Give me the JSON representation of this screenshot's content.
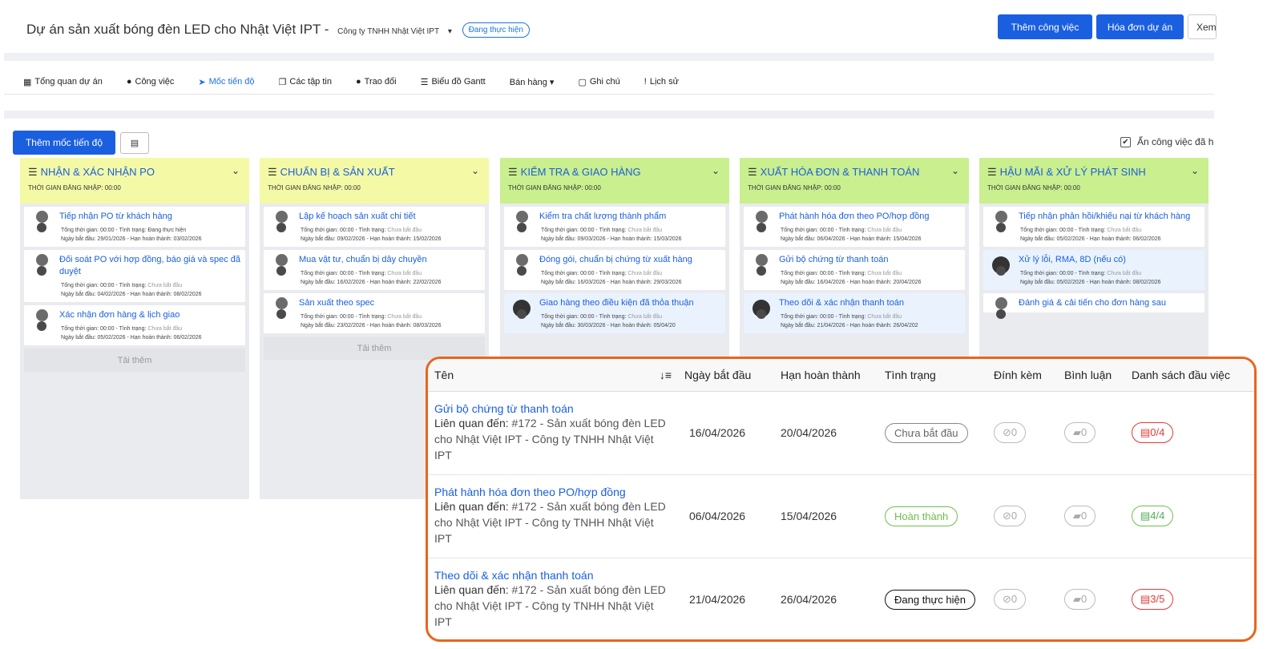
{
  "header": {
    "title": "Dự án sản xuất bóng đèn LED cho Nhật Việt IPT",
    "company": "Công ty TNHH Nhật Việt IPT",
    "status": "Đang thực hiện",
    "btn_add_task": "Thêm công việc",
    "btn_invoice": "Hóa đơn dự án",
    "btn_view": "Xem"
  },
  "nav": {
    "tabs": [
      {
        "icon": "▦",
        "label": "Tổng quan dự án"
      },
      {
        "icon": "●",
        "label": "Công việc"
      },
      {
        "icon": "➤",
        "label": "Mốc tiến độ"
      },
      {
        "icon": "❐",
        "label": "Các tập tin"
      },
      {
        "icon": "●",
        "label": "Trao đổi"
      },
      {
        "icon": "☰",
        "label": "Biểu đồ Gantt"
      },
      {
        "icon": "",
        "label": "Bán hàng ▾"
      },
      {
        "icon": "▢",
        "label": "Ghi chú"
      },
      {
        "icon": "!",
        "label": "Lịch sử"
      }
    ]
  },
  "controls": {
    "add_milestone": "Thêm mốc tiến độ",
    "hide_done": "Ẩn công việc đã h"
  },
  "columns": [
    {
      "name": "NHẬN & XÁC NHẬN PO",
      "sub": "THỜI GIAN ĐĂNG NHẬP: 00:00",
      "cards": [
        {
          "name": "Tiếp nhận PO từ khách hàng",
          "line1a": "Tổng thời gian: 00:00 - Tình trạng: ",
          "status": "Đang thực hiện",
          "line2": "Ngày bắt đầu: 29/01/2026 - Hạn hoàn thành: 03/02/2026"
        },
        {
          "name": "Đối soát PO với hợp đồng, báo giá và spec đã duyệt",
          "line1a": "Tổng thời gian: 00:00 - Tình trạng: ",
          "status": "Chưa bắt đầu",
          "line2": "Ngày bắt đầu: 04/02/2026 - Hạn hoàn thành: 08/02/2026"
        },
        {
          "name": "Xác nhận đơn hàng & lịch giao",
          "line1a": "Tổng thời gian: 00:00 - Tình trạng: ",
          "status": "Chưa bắt đầu",
          "line2": "Ngày bắt đầu: 05/02/2026 - Hạn hoàn thành: 06/02/2026"
        }
      ],
      "load_more": "Tải thêm"
    },
    {
      "name": "CHUẨN BỊ & SẢN XUẤT",
      "sub": "THỜI GIAN ĐĂNG NHẬP: 00:00",
      "cards": [
        {
          "name": "Lập kế hoạch sản xuất chi tiết",
          "line1a": "Tổng thời gian: 00:00 - Tình trạng: ",
          "status": "Chưa bắt đầu",
          "line2": "Ngày bắt đầu: 09/02/2026 - Hạn hoàn thành: 15/02/2026"
        },
        {
          "name": "Mua vật tư, chuẩn bị dây chuyền",
          "line1a": "Tổng thời gian: 00:00 - Tình trạng: ",
          "status": "Chưa bắt đầu",
          "line2": "Ngày bắt đầu: 16/02/2026 - Hạn hoàn thành: 22/02/2026"
        },
        {
          "name": "Sản xuất theo spec",
          "line1a": "Tổng thời gian: 00:00 - Tình trạng: ",
          "status": "Chưa bắt đầu",
          "line2": "Ngày bắt đầu: 23/02/2026 - Hạn hoàn thành: 08/03/2026"
        }
      ],
      "load_more": "Tải thêm"
    },
    {
      "name": "KIỂM TRA & GIAO HÀNG",
      "sub": "THỜI GIAN ĐĂNG NHẬP: 00:00",
      "cards": [
        {
          "name": "Kiểm tra chất lượng thành phẩm",
          "line1a": "Tổng thời gian: 00:00 - Tình trạng: ",
          "status": "Chưa bắt đầu",
          "line2": "Ngày bắt đầu: 09/03/2026 - Hạn hoàn thành: 15/03/2026"
        },
        {
          "name": "Đóng gói, chuẩn bị chứng từ xuất hàng",
          "line1a": "Tổng thời gian: 00:00 - Tình trạng: ",
          "status": "Chưa bắt đầu",
          "line2": "Ngày bắt đầu: 16/03/2026 - Hạn hoàn thành: 29/03/2026"
        },
        {
          "name": "Giao hàng theo điều kiện đã thỏa thuận",
          "line1a": "Tổng thời gian: 00:00 - Tình trạng: ",
          "status": "Chưa bắt đầu",
          "line2": "Ngày bắt đầu: 30/03/2026 - Hạn hoàn thành: 05/04/20"
        }
      ]
    },
    {
      "name": "XUẤT HÓA ĐƠN & THANH TOÁN",
      "sub": "THỜI GIAN ĐĂNG NHẬP: 00:00",
      "cards": [
        {
          "name": "Phát hành hóa đơn theo PO/hợp đồng",
          "line1a": "Tổng thời gian: 00:00 - Tình trạng: ",
          "status": "Chưa bắt đầu",
          "line2": "Ngày bắt đầu: 06/04/2026 - Hạn hoàn thành: 15/04/2026"
        },
        {
          "name": "Gửi bộ chứng từ thanh toán",
          "line1a": "Tổng thời gian: 00:00 - Tình trạng: ",
          "status": "Chưa bắt đầu",
          "line2": "Ngày bắt đầu: 16/04/2026 - Hạn hoàn thành: 20/04/2026"
        },
        {
          "name": "Theo dõi & xác nhận thanh toán",
          "line1a": "Tổng thời gian: 00:00 - Tình trạng: ",
          "status": "Chưa bắt đầu",
          "line2": "Ngày bắt đầu: 21/04/2026 - Hạn hoàn thành: 26/04/202"
        }
      ]
    },
    {
      "name": "HẬU MÃI & XỬ LÝ PHÁT SINH",
      "sub": "THỜI GIAN ĐĂNG NHẬP: 00:00",
      "cards": [
        {
          "name": "Tiếp nhận phản hồi/khiếu nại từ khách hàng",
          "line1a": "Tổng thời gian: 00:00 - Tình trạng: ",
          "status": "Chưa bắt đầu",
          "line2": "Ngày bắt đầu: 05/02/2026 - Hạn hoàn thành: 06/02/2026"
        },
        {
          "name": "Xử lý lỗi, RMA, 8D (nếu có)",
          "line1a": "Tổng thời gian: 00:00 - Tình trạng: ",
          "status": "Chưa bắt đầu",
          "line2": "Ngày bắt đầu: 05/02/2026 - Hạn hoàn thành: 08/02/2026"
        },
        {
          "name": "Đánh giá & cải tiến cho đơn hàng sau",
          "line1a": "",
          "status": "",
          "line2": ""
        }
      ]
    }
  ],
  "table": {
    "headers": [
      "Tên",
      "Ngày bắt đầu",
      "Hạn hoàn thành",
      "Tình trạng",
      "Đính kèm",
      "Bình luận",
      "Danh sách đầu việc"
    ],
    "related_label": "Liên quan đến:",
    "rows": [
      {
        "name": "Gửi bộ chứng từ thanh toán",
        "related": "#172 - Sản xuất bóng đèn LED cho Nhật Việt IPT - Công ty TNHH Nhật Việt IPT",
        "start": "16/04/2026",
        "due": "20/04/2026",
        "status": "Chưa bắt đầu",
        "attach": "0",
        "comments": "0",
        "checklist": "0/4"
      },
      {
        "name": "Phát hành hóa đơn theo PO/hợp đồng",
        "related": "#172 - Sản xuất bóng đèn LED cho Nhật Việt IPT - Công ty TNHH Nhật Việt IPT",
        "start": "06/04/2026",
        "due": "15/04/2026",
        "status": "Hoàn thành",
        "attach": "0",
        "comments": "0",
        "checklist": "4/4"
      },
      {
        "name": "Theo dõi & xác nhận thanh toán",
        "related": "#172 - Sản xuất bóng đèn LED cho Nhật Việt IPT - Công ty TNHH Nhật Việt IPT",
        "start": "21/04/2026",
        "due": "26/04/2026",
        "status": "Đang thực hiện",
        "attach": "0",
        "comments": "0",
        "checklist": "3/5"
      }
    ]
  },
  "colors": {
    "primary": "#1a5fe0",
    "accent_orange": "#e8651c",
    "success": "#6cc04a",
    "danger": "#e53935"
  }
}
